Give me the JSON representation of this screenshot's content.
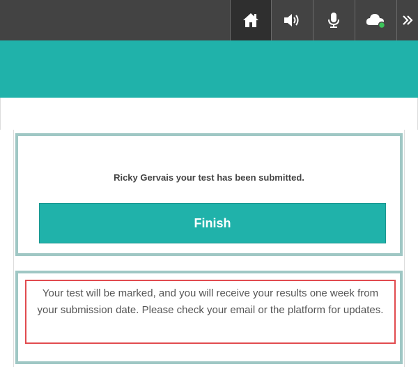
{
  "toolbar": {
    "icons": [
      "home-icon",
      "volume-icon",
      "microphone-icon",
      "cloud-icon",
      "double-chevron-right-icon"
    ],
    "status_dot_color": "#3cc45a"
  },
  "colors": {
    "toolbar_bg": "#434343",
    "accent": "#20b2aa",
    "card_border": "#9fc7c4",
    "notice_border": "#e14b4f"
  },
  "submission": {
    "message": "Ricky Gervais your test has been submitted.",
    "finish_label": "Finish"
  },
  "notice": {
    "text": "Your test will be marked, and you will receive your results one week from your submission date. Please check your email or the platform for updates."
  }
}
